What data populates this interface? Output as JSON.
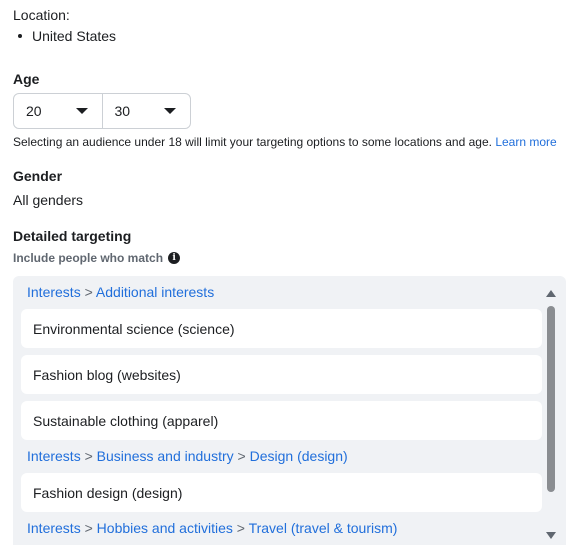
{
  "location": {
    "label": "Location:",
    "items": [
      "United States"
    ]
  },
  "age": {
    "title": "Age",
    "min": "20",
    "max": "30",
    "note": "Selecting an audience under 18 will limit your targeting options to some locations and age.",
    "learn_more": "Learn more"
  },
  "gender": {
    "title": "Gender",
    "value": "All genders"
  },
  "detailed_targeting": {
    "title": "Detailed targeting",
    "include_label": "Include people who match",
    "groups": [
      {
        "path": [
          "Interests",
          "Additional interests"
        ],
        "items": [
          "Environmental science (science)",
          "Fashion blog (websites)",
          "Sustainable clothing (apparel)"
        ]
      },
      {
        "path": [
          "Interests",
          "Business and industry",
          "Design (design)"
        ],
        "items": [
          "Fashion design (design)"
        ]
      },
      {
        "path": [
          "Interests",
          "Hobbies and activities",
          "Travel (travel & tourism)"
        ],
        "items": []
      }
    ]
  },
  "separator": ">",
  "colors": {
    "link": "#216fdb",
    "panel_bg": "#f0f2f5",
    "text": "#1c1e21"
  }
}
